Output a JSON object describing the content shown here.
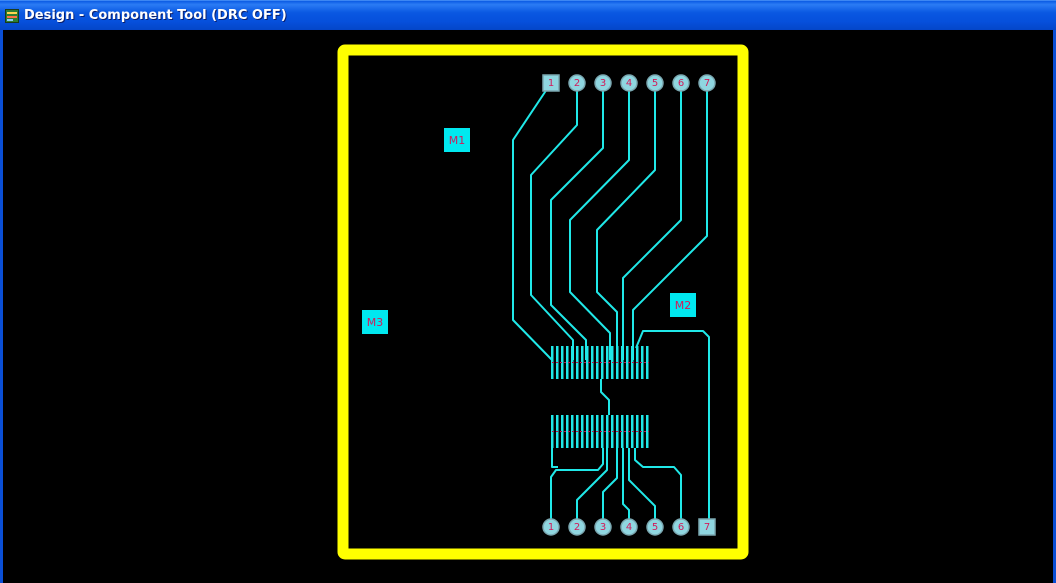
{
  "window": {
    "title": "Design - Component Tool (DRC OFF)",
    "icon": "component-tool-app-icon"
  },
  "colors": {
    "titlebar": "#0a58e2",
    "board_outline": "#ffff00",
    "trace": "#20e8e8",
    "pad_fill": "#8fd6e0",
    "component_fill": "#00e8f0",
    "label": "#d21a5a",
    "background": "#000000"
  },
  "board": {
    "components": [
      {
        "ref": "M1"
      },
      {
        "ref": "M2"
      },
      {
        "ref": "M3"
      }
    ],
    "top_pads": [
      "1",
      "2",
      "3",
      "4",
      "5",
      "6",
      "7"
    ],
    "bottom_pads": [
      "1",
      "2",
      "3",
      "4",
      "5",
      "6",
      "7"
    ]
  }
}
